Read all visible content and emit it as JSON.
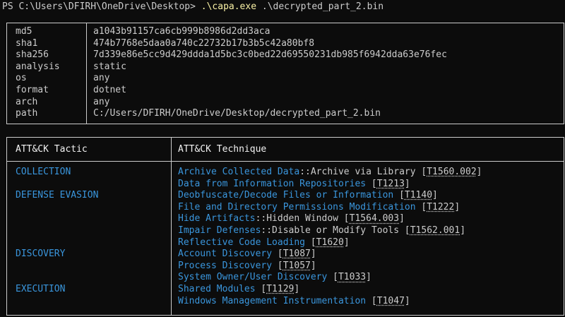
{
  "prompt": {
    "ps": "PS C:\\Users\\DFIRH\\OneDrive\\Desktop> ",
    "exe": ".\\capa.exe",
    "args": " .\\decrypted_part_2.bin"
  },
  "meta": [
    {
      "key": "md5",
      "value": "a1043b91157ca6cb999b8986d2dd3aca"
    },
    {
      "key": "sha1",
      "value": "474b7768e5daa0a740c22732b17b3b5c42a80bf8"
    },
    {
      "key": "sha256",
      "value": "7d339e86e5cc9d429ddda1d5bc3c0bed22d69550231db985f6942dda63e76fec"
    },
    {
      "key": "analysis",
      "value": "static"
    },
    {
      "key": "os",
      "value": "any"
    },
    {
      "key": "format",
      "value": "dotnet"
    },
    {
      "key": "arch",
      "value": "any"
    },
    {
      "key": "path",
      "value": "C:/Users/DFIRH/OneDrive/Desktop/decrypted_part_2.bin"
    }
  ],
  "attck": {
    "header_tactic": "ATT&CK Tactic",
    "header_technique": "ATT&CK Technique",
    "tactics": [
      {
        "row": 0,
        "label": "COLLECTION"
      },
      {
        "row": 2,
        "label": "DEFENSE EVASION"
      },
      {
        "row": 7,
        "label": "DISCOVERY"
      },
      {
        "row": 10,
        "label": "EXECUTION"
      }
    ],
    "techniques": [
      {
        "name": "Archive Collected Data",
        "sub": "::Archive via Library",
        "id": "T1560.002"
      },
      {
        "name": "Data from Information Repositories",
        "sub": "",
        "id": "T1213"
      },
      {
        "name": "Deobfuscate/Decode Files or Information",
        "sub": "",
        "id": "T1140"
      },
      {
        "name": "File and Directory Permissions Modification",
        "sub": "",
        "id": "T1222"
      },
      {
        "name": "Hide Artifacts",
        "sub": "::Hidden Window",
        "id": "T1564.003"
      },
      {
        "name": "Impair Defenses",
        "sub": "::Disable or Modify Tools",
        "id": "T1562.001"
      },
      {
        "name": "Reflective Code Loading",
        "sub": "",
        "id": "T1620"
      },
      {
        "name": "Account Discovery",
        "sub": "",
        "id": "T1087"
      },
      {
        "name": "Process Discovery",
        "sub": "",
        "id": "T1057"
      },
      {
        "name": "System Owner/User Discovery",
        "sub": "",
        "id": "T1033"
      },
      {
        "name": "Shared Modules",
        "sub": "",
        "id": "T1129"
      },
      {
        "name": "Windows Management Instrumentation",
        "sub": "",
        "id": "T1047"
      }
    ]
  }
}
